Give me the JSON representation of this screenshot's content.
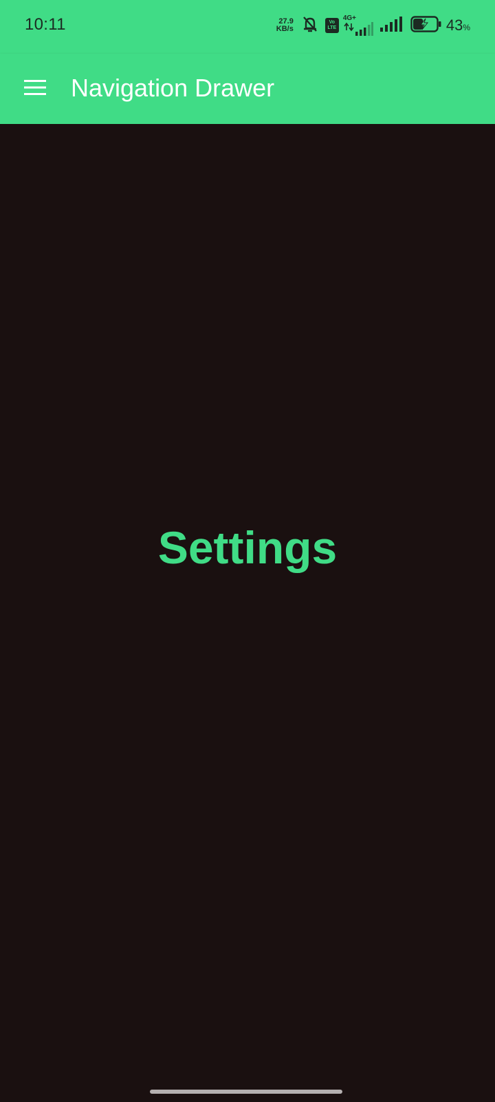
{
  "status_bar": {
    "time": "10:11",
    "net_speed_value": "27.9",
    "net_speed_unit": "KB/s",
    "volte_top": "Vo",
    "volte_bottom": "LTE",
    "network_type": "4G+",
    "battery_percent": "43",
    "battery_unit": "%",
    "battery_level": 0.43,
    "icons": [
      "mute-bell-icon",
      "volte-icon",
      "signal-4g-icon",
      "signal-icon",
      "battery-charging-icon"
    ]
  },
  "app_bar": {
    "menu_icon": "hamburger-menu-icon",
    "title": "Navigation Drawer"
  },
  "content": {
    "label": "Settings"
  },
  "colors": {
    "accent": "#40dc86",
    "background": "#1a1010",
    "title_text": "#ffffff",
    "status_text": "#1c2a22"
  }
}
